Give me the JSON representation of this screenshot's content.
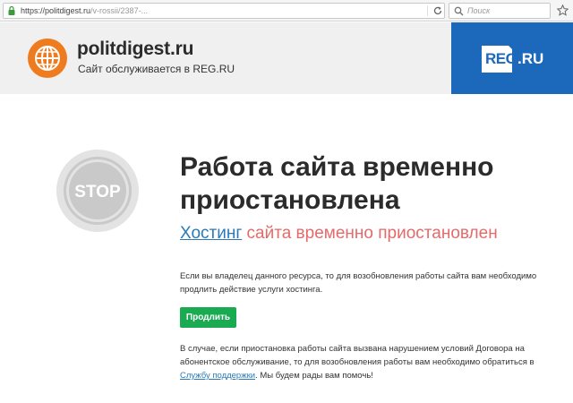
{
  "browser": {
    "url_host": "https://politdigest.ru",
    "url_path": "/v-rossii/2387-...",
    "search_placeholder": "Поиск"
  },
  "header": {
    "site_name": "politdigest.ru",
    "site_subtitle": "Сайт обслуживается в REG.RU",
    "logo_reg": "REG",
    "logo_ru": ".RU",
    "brand_color": "#1c69bb"
  },
  "main": {
    "stop_text": "STOP",
    "title": "Работа сайта временно приостановлена",
    "subtitle_link": "Хостинг",
    "subtitle_rest": "сайта временно приостановлен",
    "para1": "Если вы владелец данного ресурса, то для возобновления работы сайта вам необходимо продлить действие услуги хостинга.",
    "renew_button": "Продлить",
    "para2_before": "В случае, если приостановка работы сайта вызвана нарушением условий Договора на абонентское обслуживание, то для возобновления работы вам необходимо обратиться в",
    "support_link": "Службу поддержки",
    "para2_after": ". Мы будем рады вам помочь!"
  },
  "colors": {
    "link": "#2a7ab9",
    "alert": "#e46a6a",
    "button": "#1aaa52",
    "globe": "#ef7b1f"
  }
}
